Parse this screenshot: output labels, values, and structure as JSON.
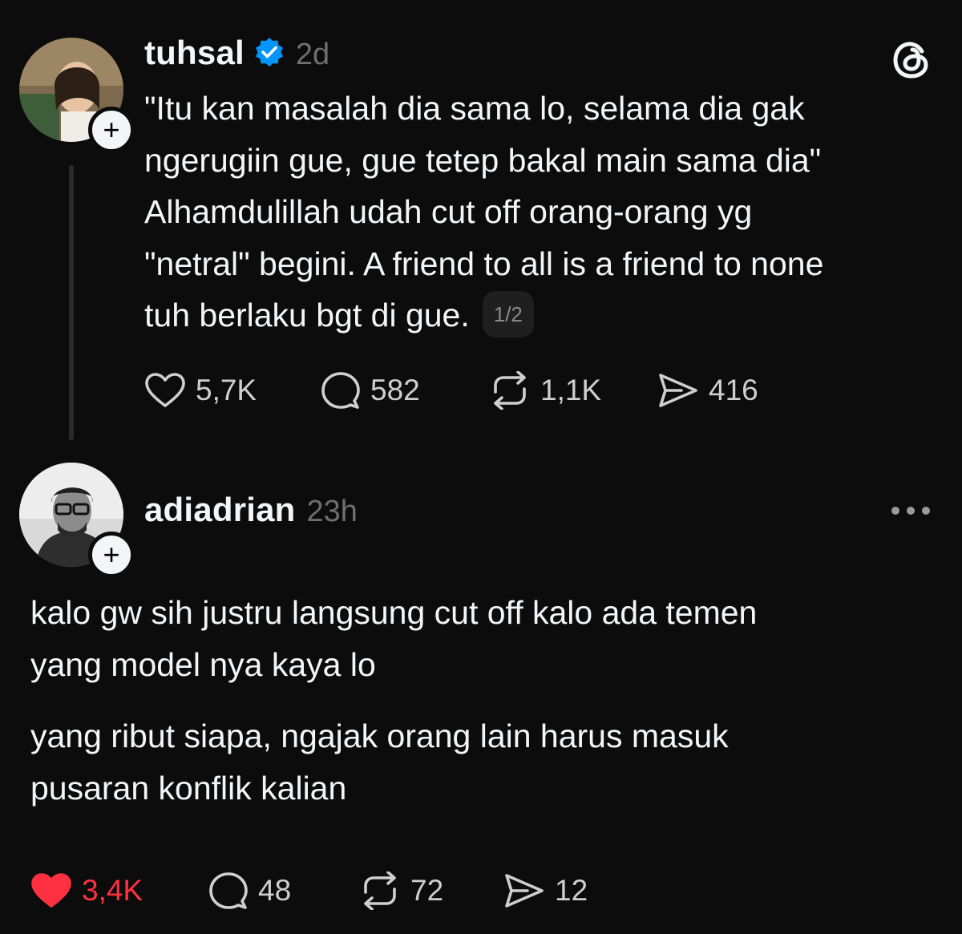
{
  "posts": [
    {
      "username": "tuhsal",
      "verified": true,
      "time": "2d",
      "text": "\"Itu kan masalah dia sama lo, selama dia gak\nngerugiin gue, gue tetep bakal main sama dia\"\nAlhamdulillah udah cut off orang-orang yg\n\"netral\" begini. A friend to all is a friend to none\ntuh berlaku bgt di gue.",
      "page_indicator": "1/2",
      "likes": "5,7K",
      "replies": "582",
      "reposts": "1,1K",
      "shares": "416",
      "liked": false
    },
    {
      "username": "adiadrian",
      "time": "23h",
      "paragraph_1": "kalo gw sih justru langsung cut off kalo ada temen\nyang model nya kaya lo",
      "paragraph_2": "yang ribut siapa, ngajak orang lain harus masuk\npusaran konflik kalian",
      "likes": "3,4K",
      "replies": "48",
      "reposts": "72",
      "shares": "12",
      "liked": true
    }
  ],
  "colors": {
    "background": "#0c0c0c",
    "text": "#f3f5f7",
    "muted": "#6f6f6f",
    "liked": "#ff3040",
    "verified": "#0095f6"
  },
  "icons": {
    "logo": "threads-logo-icon",
    "like": "heart-icon",
    "reply": "comment-icon",
    "repost": "repost-icon",
    "share": "send-icon",
    "more": "more-options-icon",
    "follow": "plus-icon",
    "verified": "verified-badge-icon"
  }
}
